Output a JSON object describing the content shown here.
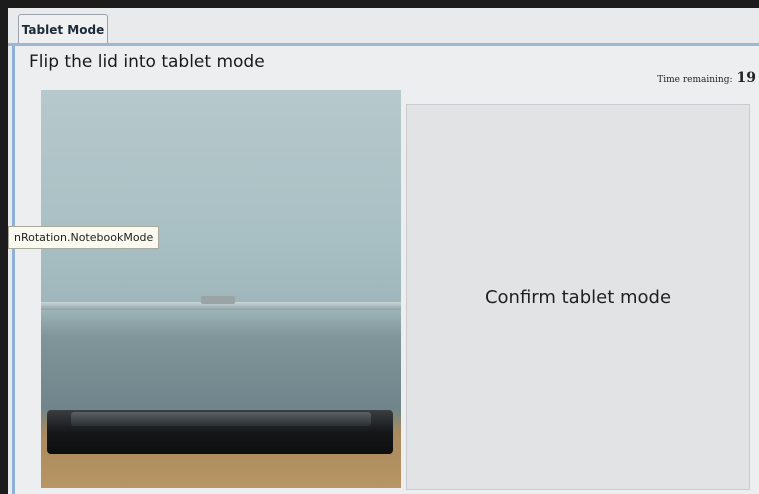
{
  "window": {
    "tab_label": "Tablet Mode"
  },
  "main": {
    "instruction": "Flip the lid into tablet mode",
    "timer": {
      "label": "Time remaining:",
      "value": "19"
    },
    "confirm_label": "Confirm tablet mode"
  },
  "tooltip": {
    "text": "nRotation.NotebookMode"
  }
}
